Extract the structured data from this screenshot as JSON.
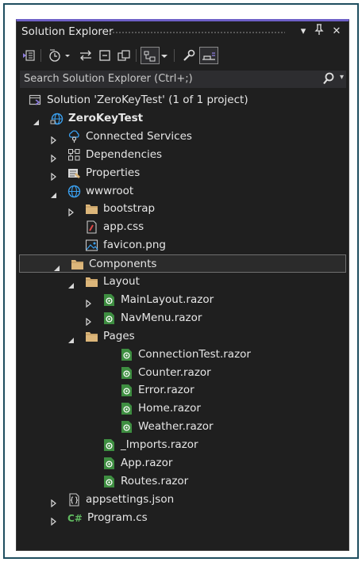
{
  "panel": {
    "title": "Solution Explorer",
    "pin_glyph": "▾",
    "pin_icon_glyph": "⭳",
    "close_glyph": "✕"
  },
  "search": {
    "placeholder": "Search Solution Explorer (Ctrl+;)"
  },
  "colors": {
    "accent": "#6e60c8",
    "panel_bg": "#1f1f1f",
    "folder": "#dcb67a",
    "razor": "#3e8e41",
    "selected_border": "#6f6f6f"
  },
  "tree": [
    {
      "label": "Solution 'ZeroKeyTest' (1 of 1 project)",
      "icon": "solution-icon",
      "expander": "none"
    },
    {
      "label": "ZeroKeyTest",
      "icon": "web-project-icon",
      "expander": "expanded",
      "bold": true
    },
    {
      "label": "Connected Services",
      "icon": "connected-services-icon",
      "expander": "collapsed"
    },
    {
      "label": "Dependencies",
      "icon": "dependencies-icon",
      "expander": "collapsed"
    },
    {
      "label": "Properties",
      "icon": "properties-icon",
      "expander": "collapsed"
    },
    {
      "label": "wwwroot",
      "icon": "globe-icon",
      "expander": "expanded"
    },
    {
      "label": "bootstrap",
      "icon": "folder-icon",
      "expander": "collapsed"
    },
    {
      "label": "app.css",
      "icon": "css-file-icon",
      "expander": "none"
    },
    {
      "label": "favicon.png",
      "icon": "image-file-icon",
      "expander": "none"
    },
    {
      "label": "Components",
      "icon": "folder-icon",
      "expander": "expanded",
      "selected": true
    },
    {
      "label": "Layout",
      "icon": "folder-icon",
      "expander": "expanded"
    },
    {
      "label": "MainLayout.razor",
      "icon": "razor-file-icon",
      "expander": "collapsed"
    },
    {
      "label": "NavMenu.razor",
      "icon": "razor-file-icon",
      "expander": "collapsed"
    },
    {
      "label": "Pages",
      "icon": "folder-icon",
      "expander": "expanded"
    },
    {
      "label": "ConnectionTest.razor",
      "icon": "razor-file-icon",
      "expander": "none"
    },
    {
      "label": "Counter.razor",
      "icon": "razor-file-icon",
      "expander": "none"
    },
    {
      "label": "Error.razor",
      "icon": "razor-file-icon",
      "expander": "none"
    },
    {
      "label": "Home.razor",
      "icon": "razor-file-icon",
      "expander": "none"
    },
    {
      "label": "Weather.razor",
      "icon": "razor-file-icon",
      "expander": "none"
    },
    {
      "label": "_Imports.razor",
      "icon": "razor-file-icon",
      "expander": "none"
    },
    {
      "label": "App.razor",
      "icon": "razor-file-icon",
      "expander": "none"
    },
    {
      "label": "Routes.razor",
      "icon": "razor-file-icon",
      "expander": "none"
    },
    {
      "label": "appsettings.json",
      "icon": "json-file-icon",
      "expander": "collapsed"
    },
    {
      "label": "Program.cs",
      "icon": "csharp-file-icon",
      "expander": "collapsed"
    }
  ]
}
